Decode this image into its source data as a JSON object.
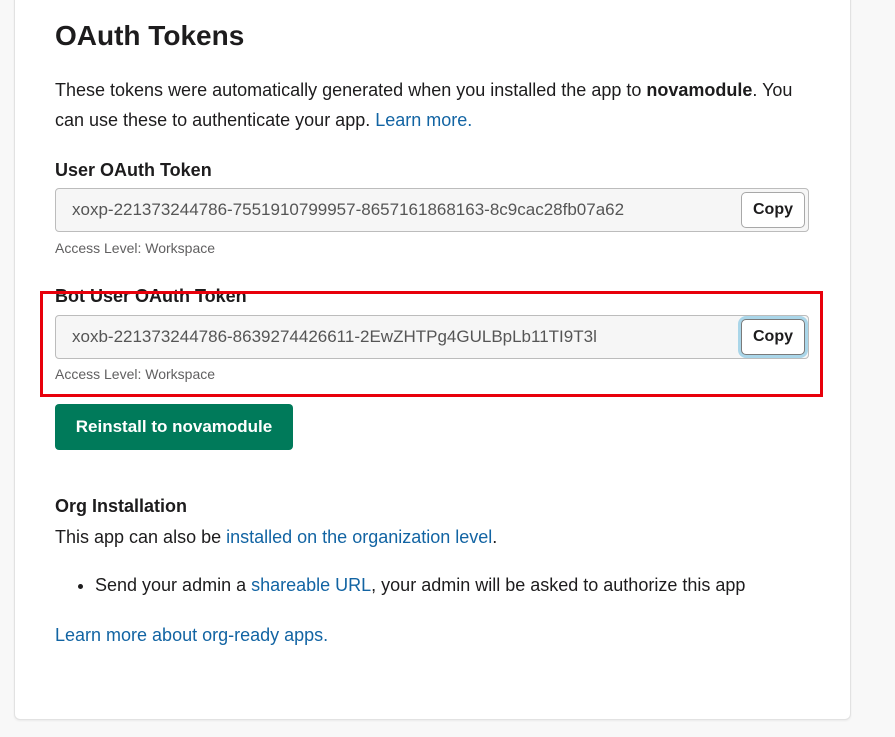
{
  "page": {
    "title": "OAuth Tokens",
    "intro_pre": "These tokens were automatically generated when you installed the app to ",
    "app_name": "novamodule",
    "intro_post": ". You can use these to authenticate your app. ",
    "intro_link": "Learn more."
  },
  "user_token": {
    "label": "User OAuth Token",
    "value": "xoxp-221373244786-7551910799957-8657161868163-8c9cac28fb07a62",
    "copy_label": "Copy",
    "access_level": "Access Level: Workspace"
  },
  "bot_token": {
    "label": "Bot User OAuth Token",
    "value": "xoxb-221373244786-8639274426611-2EwZHTPg4GULBpLb11TI9T3l",
    "copy_label": "Copy",
    "access_level": "Access Level: Workspace"
  },
  "reinstall_button": "Reinstall to novamodule",
  "org": {
    "title": "Org Installation",
    "text_pre": "This app can also be ",
    "text_link": "installed on the organization level",
    "text_post": ".",
    "bullet_pre": "Send your admin a ",
    "bullet_link": "shareable URL",
    "bullet_post": ", your admin will be asked to authorize this app",
    "learn_more": "Learn more about org-ready apps."
  },
  "colors": {
    "link": "#1264a3",
    "primary_button": "#007a5a",
    "highlight": "#e8000b"
  }
}
